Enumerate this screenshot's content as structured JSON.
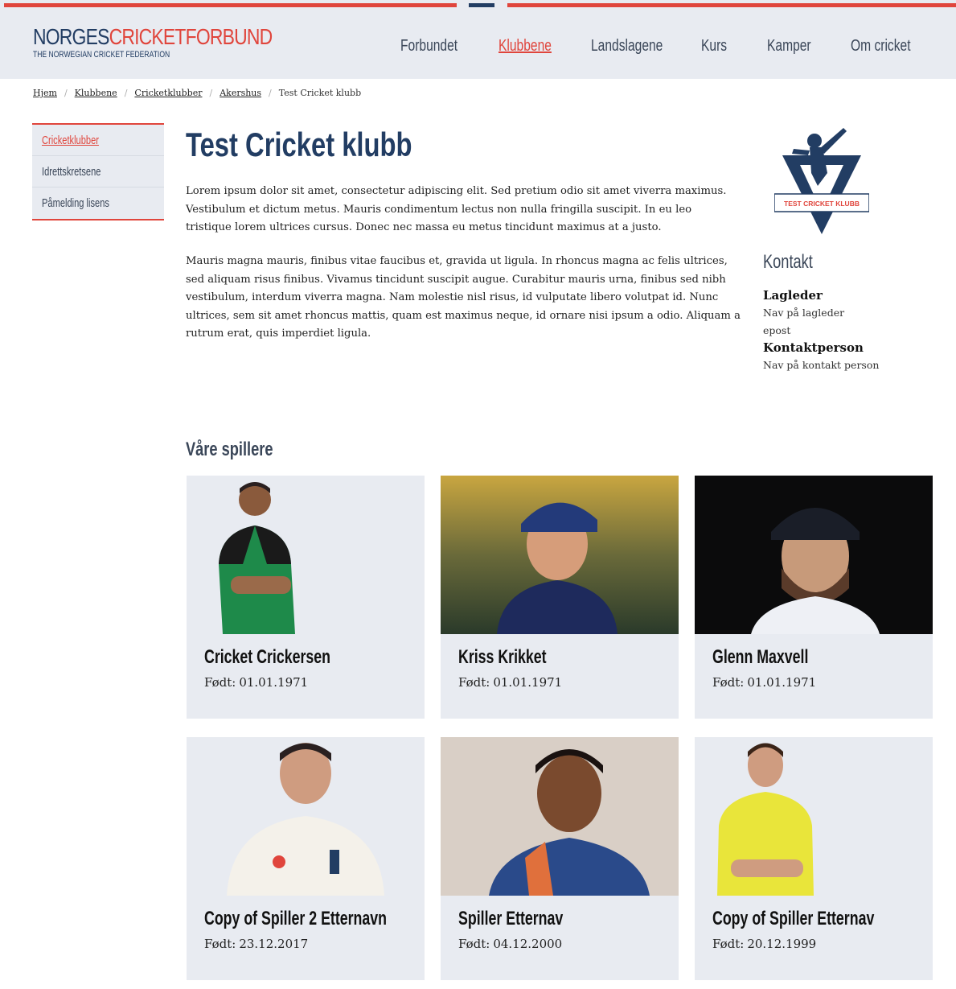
{
  "header": {
    "logo_norges": "NORGES",
    "logo_cricket": "CRICKETFORBUND",
    "logo_sub": "THE NORWEGIAN CRICKET FEDERATION",
    "nav": [
      {
        "label": "Forbundet"
      },
      {
        "label": "Klubbene"
      },
      {
        "label": "Landslagene"
      },
      {
        "label": "Kurs"
      },
      {
        "label": "Kamper"
      },
      {
        "label": "Om cricket"
      }
    ]
  },
  "breadcrumb": [
    "Hjem",
    "Klubbene",
    "Cricketklubber",
    "Akershus",
    "Test Cricket klubb"
  ],
  "sidebar": {
    "items": [
      {
        "label": "Cricketklubber"
      },
      {
        "label": "Idrettskretsene"
      },
      {
        "label": "Påmelding lisens"
      }
    ]
  },
  "main": {
    "title": "Test Cricket klubb",
    "paragraphs": [
      "Lorem ipsum dolor sit amet, consectetur adipiscing elit. Sed pretium odio sit amet viverra maximus. Vestibulum et dictum metus. Mauris condimentum lectus non nulla fringilla suscipit. In eu leo tristique lorem ultrices cursus. Donec nec massa eu metus tincidunt maximus at a justo.",
      "Mauris magna mauris, finibus vitae faucibus et, gravida ut ligula. In rhoncus magna ac felis ultrices, sed aliquam risus finibus. Vivamus tincidunt suscipit augue. Curabitur mauris urna, finibus sed nibh vestibulum, interdum viverra magna. Nam molestie nisl risus, id vulputate libero volutpat id. Nunc ultrices, sem sit amet rhoncus mattis, quam est maximus neque, id ornare nisi ipsum a odio. Aliquam a rutrum erat, quis imperdiet ligula."
    ]
  },
  "club_logo": {
    "text": "TEST CRICKET KLUBB"
  },
  "contact": {
    "title": "Kontakt",
    "lagleder_role": "Lagleder",
    "lagleder_name": "Nav på lagleder",
    "lagleder_epost": "epost",
    "kontakt_role": "Kontaktperson",
    "kontakt_name": "Nav på kontakt person"
  },
  "players": {
    "title": "Våre spillere",
    "born_label": "Født:",
    "list": [
      {
        "name": "Cricket Crickersen",
        "born": "01.01.1971"
      },
      {
        "name": "Kriss Krikket",
        "born": "01.01.1971"
      },
      {
        "name": "Glenn Maxvell",
        "born": "01.01.1971"
      },
      {
        "name": "Copy of Spiller 2 Etternavn",
        "born": "23.12.2017"
      },
      {
        "name": "Spiller Etternav",
        "born": "04.12.2000"
      },
      {
        "name": "Copy of Spiller Etternav",
        "born": "20.12.1999"
      }
    ]
  },
  "colors": {
    "brand_red": "#e0453c",
    "brand_navy": "#223d63",
    "panel_bg": "#e8ebf1"
  }
}
